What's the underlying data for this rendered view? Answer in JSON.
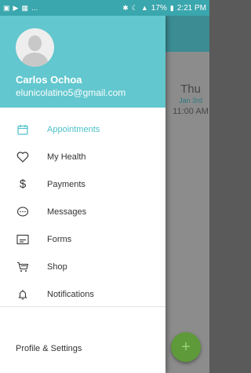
{
  "status_bar": {
    "left_icons": [
      "gallery-icon",
      "play-store-icon",
      "image-icon"
    ],
    "ellipsis": "...",
    "battery": "17%",
    "time": "2:21 PM"
  },
  "background": {
    "day": "Thu",
    "date": "Jan 3rd",
    "time": "11:00 AM",
    "fab_label": "+"
  },
  "drawer": {
    "user_name": "Carlos Ochoa",
    "user_email": "elunicolatino5@gmail.com",
    "menu": [
      {
        "label": "Appointments",
        "icon": "calendar-icon",
        "active": true
      },
      {
        "label": "My Health",
        "icon": "heart-icon",
        "active": false
      },
      {
        "label": "Payments",
        "icon": "dollar-icon",
        "active": false
      },
      {
        "label": "Messages",
        "icon": "chat-bubble-icon",
        "active": false
      },
      {
        "label": "Forms",
        "icon": "form-icon",
        "active": false
      },
      {
        "label": "Shop",
        "icon": "cart-icon",
        "active": false
      },
      {
        "label": "Notifications",
        "icon": "bell-icon",
        "active": false
      }
    ],
    "settings_label": "Profile & Settings"
  },
  "colors": {
    "accent": "#4cc1c9",
    "header": "#62c7ce",
    "status_bar": "#3aa6ad",
    "fab": "#5f9a3a"
  }
}
